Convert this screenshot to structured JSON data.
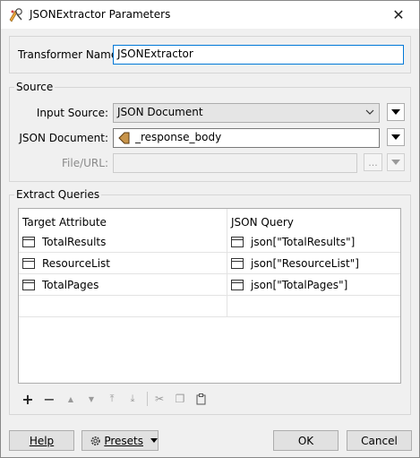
{
  "window": {
    "title": "JSONExtractor Parameters",
    "close_symbol": "✕"
  },
  "transformer_name": {
    "label": "Transformer Name:",
    "value": "JSONExtractor"
  },
  "source": {
    "group_title": "Source",
    "input_source_label": "Input Source:",
    "input_source_value": "JSON Document",
    "json_document_label": "JSON Document:",
    "json_document_value": "_response_body",
    "file_url_label": "File/URL:",
    "file_url_value": "",
    "browse_label": "..."
  },
  "extract_queries": {
    "group_title": "Extract Queries",
    "columns": [
      "Target Attribute",
      "JSON Query"
    ],
    "rows": [
      {
        "target": "TotalResults",
        "query": "json[\"TotalResults\"]"
      },
      {
        "target": "ResourceList",
        "query": "json[\"ResourceList\"]"
      },
      {
        "target": "TotalPages",
        "query": "json[\"TotalPages\"]"
      }
    ]
  },
  "toolbar": {
    "add_icon": "+",
    "remove_icon": "−",
    "move_up_icon": "▲",
    "move_down_icon": "▼",
    "move_top_icon": "⤒",
    "move_bottom_icon": "⤓",
    "cut_icon": "✂",
    "copy_icon": "❐",
    "paste_icon": "📋"
  },
  "buttons": {
    "help": "Help",
    "presets": "Presets",
    "ok": "OK",
    "cancel": "Cancel"
  },
  "colors": {
    "accent": "#0078d7",
    "attribute_icon": "#c8944a"
  }
}
